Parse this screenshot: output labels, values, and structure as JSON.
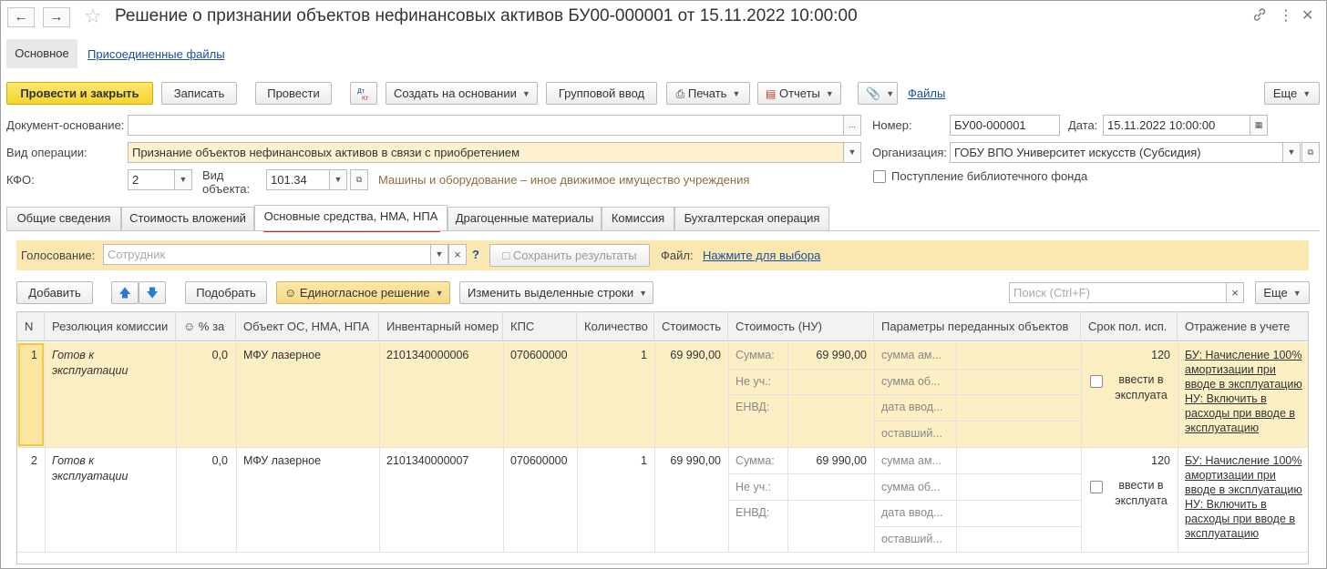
{
  "window": {
    "title": "Решение о признании объектов нефинансовых активов БУ00-000001 от 15.11.2022 10:00:00",
    "back_glyph": "🡐",
    "forward_glyph": "🡒"
  },
  "sections": {
    "main": "Основное",
    "files": "Присоединенные файлы"
  },
  "toolbar": {
    "post_close": "Провести и закрыть",
    "save": "Записать",
    "post": "Провести",
    "dt_kt": "Дт/Кт",
    "create_based": "Создать на основании",
    "group_input": "Групповой ввод",
    "print": "Печать",
    "reports": "Отчеты",
    "files_link": "Файлы",
    "more": "Еще"
  },
  "form": {
    "base_doc_label": "Документ-основание:",
    "base_doc_value": "",
    "op_label": "Вид операции:",
    "op_value": "Признание объектов нефинансовых активов в связи с приобретением",
    "kfo_label": "КФО:",
    "kfo_value": "2",
    "obj_type_label_1": "Вид",
    "obj_type_label_2": "объекта:",
    "obj_type_value": "101.34",
    "obj_type_desc": "Машины и оборудование – иное движимое имущество учреждения",
    "number_label": "Номер:",
    "number_value": "БУ00-000001",
    "date_label": "Дата:",
    "date_value": "15.11.2022 10:00:00",
    "org_label": "Организация:",
    "org_value": "ГОБУ ВПО Университет искусств (Субсидия)",
    "library_fund": "Поступление библиотечного фонда"
  },
  "tabs": [
    {
      "label": "Общие сведения"
    },
    {
      "label": "Стоимость вложений"
    },
    {
      "label": "Основные средства, НМА, НПА"
    },
    {
      "label": "Драгоценные материалы"
    },
    {
      "label": "Комиссия"
    },
    {
      "label": "Бухгалтерская операция"
    }
  ],
  "vote": {
    "label": "Голосование:",
    "placeholder": "Сотрудник",
    "clear": "×",
    "help": "?",
    "save_results": "Сохранить результаты",
    "file_label": "Файл:",
    "file_link": "Нажмите для выбора"
  },
  "table_toolbar": {
    "add": "Добавить",
    "select": "Подобрать",
    "unanimous": "Единогласное решение",
    "change_rows": "Изменить выделенные строки",
    "search_placeholder": "Поиск (Ctrl+F)",
    "more": "Еще"
  },
  "columns": {
    "n": "N",
    "resolution": "Резолюция комиссии",
    "pct": "% за",
    "object": "Объект ОС, НМА, НПА",
    "inv": "Инвентарный номер",
    "kps": "КПС",
    "qty": "Количество",
    "cost": "Стоимость",
    "cost_nu": "Стоимость (НУ)",
    "params": "Параметры переданных объектов",
    "term": "Срок пол. исп.",
    "reflect": "Отражение в учете"
  },
  "rows": [
    {
      "n": "1",
      "resolution": "Готов к эксплуатации",
      "pct": "0,0",
      "object": "МФУ лазерное",
      "inv": "2101340000006",
      "kps": "070600000",
      "qty": "1",
      "cost": "69 990,00",
      "sum_label": "Сумма:",
      "sum_value": "69 990,00",
      "nu_label": "Не уч.:",
      "envd_label": "ЕНВД:",
      "p1": "сумма ам...",
      "p2": "сумма об...",
      "p3": "дата ввод...",
      "p4": "оставший...",
      "term": "120",
      "commission": "ввести в эксплуата",
      "reflect_bu": "БУ: Начисление 100% амортизации при вводе в эксплуатацию",
      "reflect_nu": "НУ: Включить в расходы при вводе в эксплуатацию"
    },
    {
      "n": "2",
      "resolution": "Готов к эксплуатации",
      "pct": "0,0",
      "object": "МФУ лазерное",
      "inv": "2101340000007",
      "kps": "070600000",
      "qty": "1",
      "cost": "69 990,00",
      "sum_label": "Сумма:",
      "sum_value": "69 990,00",
      "nu_label": "Не уч.:",
      "envd_label": "ЕНВД:",
      "p1": "сумма ам...",
      "p2": "сумма об...",
      "p3": "дата ввод...",
      "p4": "оставший...",
      "term": "120",
      "commission": "ввести в эксплуата",
      "reflect_bu": "БУ: Начисление 100% амортизации при вводе в эксплуатацию",
      "reflect_nu": "НУ: Включить в расходы при вводе в эксплуатацию"
    }
  ],
  "colors": {
    "accent_yellow": "#f5d42a",
    "selected_row": "#fcefc4",
    "link": "#1a4fa0",
    "active_tab_underline": "#d62b2b"
  }
}
